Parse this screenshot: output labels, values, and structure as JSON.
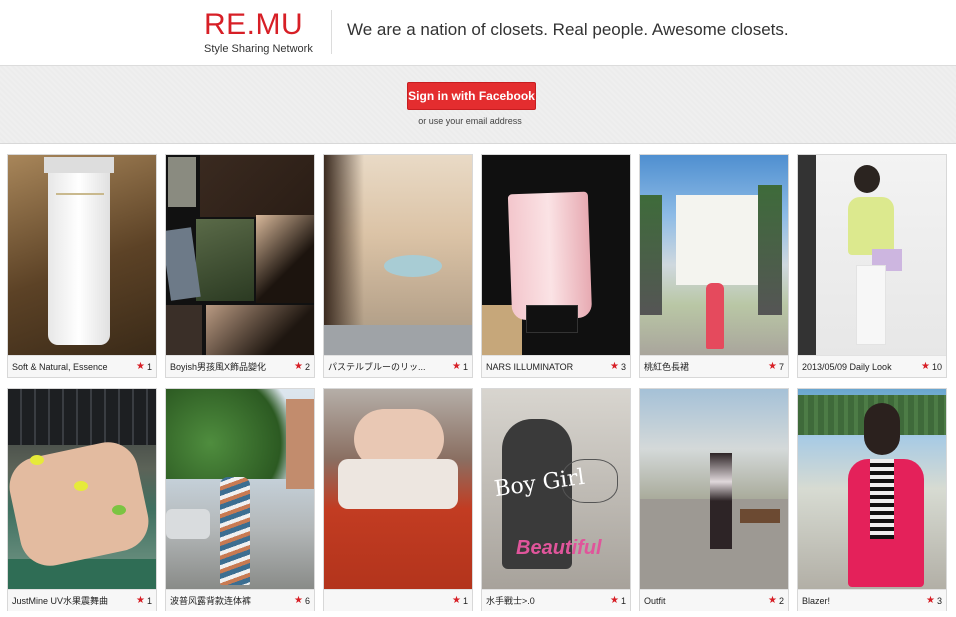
{
  "header": {
    "logo": "RE.MU",
    "logo_sub": "Style Sharing Network",
    "tagline": "We are a nation of closets. Real people. Awesome closets."
  },
  "signin": {
    "facebook_label": "Sign in with Facebook",
    "email_label": "or use your email address"
  },
  "items": [
    {
      "title": "Soft & Natural, Essence",
      "stars": "1"
    },
    {
      "title": "Boyish男孩風X飾品變化",
      "stars": "2"
    },
    {
      "title": "パステルブルーのリッ...",
      "stars": "1"
    },
    {
      "title": "NARS ILLUMINATOR",
      "stars": "3"
    },
    {
      "title": "桃紅色長裙",
      "stars": "7"
    },
    {
      "title": "2013/05/09 Daily Look",
      "stars": "10"
    },
    {
      "title": "JustMine UV水果震舞曲",
      "stars": "1"
    },
    {
      "title": "波普风露背款连体裤",
      "stars": "6"
    },
    {
      "title": "",
      "stars": "1"
    },
    {
      "title": "水手戰士>.0",
      "stars": "1"
    },
    {
      "title": "Outfit",
      "stars": "2"
    },
    {
      "title": "Blazer!",
      "stars": "3"
    }
  ],
  "photo_text": {
    "boy_girl": "Boy Girl",
    "beautiful": "Beautiful"
  },
  "colors": {
    "brand_red": "#d71f26",
    "facebook_button": "#e42d2f"
  }
}
